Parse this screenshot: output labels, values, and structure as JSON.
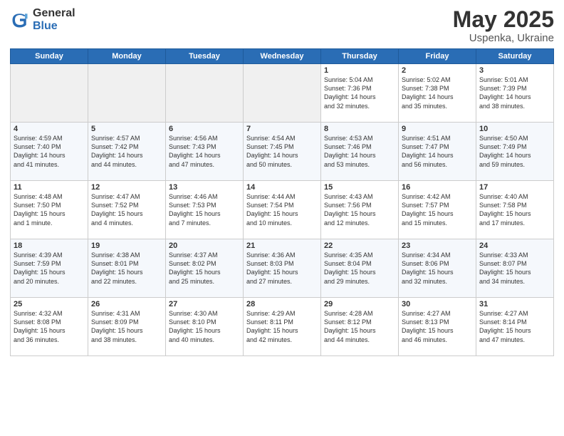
{
  "header": {
    "logo_general": "General",
    "logo_blue": "Blue",
    "title": "May 2025",
    "location": "Uspenka, Ukraine"
  },
  "weekdays": [
    "Sunday",
    "Monday",
    "Tuesday",
    "Wednesday",
    "Thursday",
    "Friday",
    "Saturday"
  ],
  "weeks": [
    [
      {
        "day": "",
        "info": ""
      },
      {
        "day": "",
        "info": ""
      },
      {
        "day": "",
        "info": ""
      },
      {
        "day": "",
        "info": ""
      },
      {
        "day": "1",
        "info": "Sunrise: 5:04 AM\nSunset: 7:36 PM\nDaylight: 14 hours\nand 32 minutes."
      },
      {
        "day": "2",
        "info": "Sunrise: 5:02 AM\nSunset: 7:38 PM\nDaylight: 14 hours\nand 35 minutes."
      },
      {
        "day": "3",
        "info": "Sunrise: 5:01 AM\nSunset: 7:39 PM\nDaylight: 14 hours\nand 38 minutes."
      }
    ],
    [
      {
        "day": "4",
        "info": "Sunrise: 4:59 AM\nSunset: 7:40 PM\nDaylight: 14 hours\nand 41 minutes."
      },
      {
        "day": "5",
        "info": "Sunrise: 4:57 AM\nSunset: 7:42 PM\nDaylight: 14 hours\nand 44 minutes."
      },
      {
        "day": "6",
        "info": "Sunrise: 4:56 AM\nSunset: 7:43 PM\nDaylight: 14 hours\nand 47 minutes."
      },
      {
        "day": "7",
        "info": "Sunrise: 4:54 AM\nSunset: 7:45 PM\nDaylight: 14 hours\nand 50 minutes."
      },
      {
        "day": "8",
        "info": "Sunrise: 4:53 AM\nSunset: 7:46 PM\nDaylight: 14 hours\nand 53 minutes."
      },
      {
        "day": "9",
        "info": "Sunrise: 4:51 AM\nSunset: 7:47 PM\nDaylight: 14 hours\nand 56 minutes."
      },
      {
        "day": "10",
        "info": "Sunrise: 4:50 AM\nSunset: 7:49 PM\nDaylight: 14 hours\nand 59 minutes."
      }
    ],
    [
      {
        "day": "11",
        "info": "Sunrise: 4:48 AM\nSunset: 7:50 PM\nDaylight: 15 hours\nand 1 minute."
      },
      {
        "day": "12",
        "info": "Sunrise: 4:47 AM\nSunset: 7:52 PM\nDaylight: 15 hours\nand 4 minutes."
      },
      {
        "day": "13",
        "info": "Sunrise: 4:46 AM\nSunset: 7:53 PM\nDaylight: 15 hours\nand 7 minutes."
      },
      {
        "day": "14",
        "info": "Sunrise: 4:44 AM\nSunset: 7:54 PM\nDaylight: 15 hours\nand 10 minutes."
      },
      {
        "day": "15",
        "info": "Sunrise: 4:43 AM\nSunset: 7:56 PM\nDaylight: 15 hours\nand 12 minutes."
      },
      {
        "day": "16",
        "info": "Sunrise: 4:42 AM\nSunset: 7:57 PM\nDaylight: 15 hours\nand 15 minutes."
      },
      {
        "day": "17",
        "info": "Sunrise: 4:40 AM\nSunset: 7:58 PM\nDaylight: 15 hours\nand 17 minutes."
      }
    ],
    [
      {
        "day": "18",
        "info": "Sunrise: 4:39 AM\nSunset: 7:59 PM\nDaylight: 15 hours\nand 20 minutes."
      },
      {
        "day": "19",
        "info": "Sunrise: 4:38 AM\nSunset: 8:01 PM\nDaylight: 15 hours\nand 22 minutes."
      },
      {
        "day": "20",
        "info": "Sunrise: 4:37 AM\nSunset: 8:02 PM\nDaylight: 15 hours\nand 25 minutes."
      },
      {
        "day": "21",
        "info": "Sunrise: 4:36 AM\nSunset: 8:03 PM\nDaylight: 15 hours\nand 27 minutes."
      },
      {
        "day": "22",
        "info": "Sunrise: 4:35 AM\nSunset: 8:04 PM\nDaylight: 15 hours\nand 29 minutes."
      },
      {
        "day": "23",
        "info": "Sunrise: 4:34 AM\nSunset: 8:06 PM\nDaylight: 15 hours\nand 32 minutes."
      },
      {
        "day": "24",
        "info": "Sunrise: 4:33 AM\nSunset: 8:07 PM\nDaylight: 15 hours\nand 34 minutes."
      }
    ],
    [
      {
        "day": "25",
        "info": "Sunrise: 4:32 AM\nSunset: 8:08 PM\nDaylight: 15 hours\nand 36 minutes."
      },
      {
        "day": "26",
        "info": "Sunrise: 4:31 AM\nSunset: 8:09 PM\nDaylight: 15 hours\nand 38 minutes."
      },
      {
        "day": "27",
        "info": "Sunrise: 4:30 AM\nSunset: 8:10 PM\nDaylight: 15 hours\nand 40 minutes."
      },
      {
        "day": "28",
        "info": "Sunrise: 4:29 AM\nSunset: 8:11 PM\nDaylight: 15 hours\nand 42 minutes."
      },
      {
        "day": "29",
        "info": "Sunrise: 4:28 AM\nSunset: 8:12 PM\nDaylight: 15 hours\nand 44 minutes."
      },
      {
        "day": "30",
        "info": "Sunrise: 4:27 AM\nSunset: 8:13 PM\nDaylight: 15 hours\nand 46 minutes."
      },
      {
        "day": "31",
        "info": "Sunrise: 4:27 AM\nSunset: 8:14 PM\nDaylight: 15 hours\nand 47 minutes."
      }
    ]
  ]
}
